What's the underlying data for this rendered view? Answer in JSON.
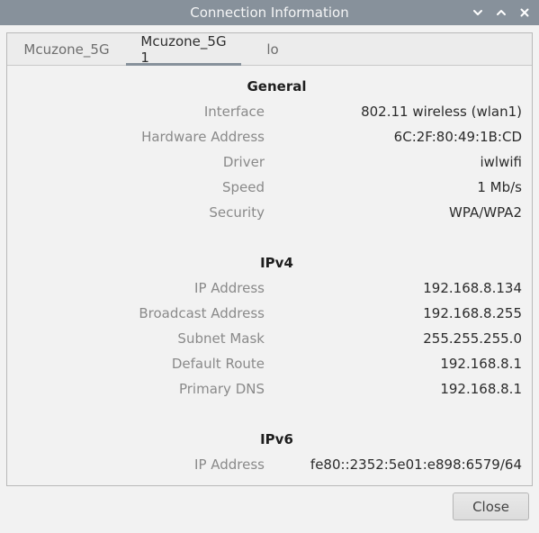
{
  "window": {
    "title": "Connection Information",
    "controls": [
      "chevron-down-icon",
      "chevron-up-icon",
      "close-icon"
    ]
  },
  "tabs": [
    {
      "label": "Mcuzone_5G",
      "active": false
    },
    {
      "label": "Mcuzone_5G 1",
      "active": true
    },
    {
      "label": "lo",
      "active": false
    }
  ],
  "general": {
    "title": "General",
    "rows": [
      {
        "label": "Interface",
        "value": "802.11 wireless (wlan1)"
      },
      {
        "label": "Hardware Address",
        "value": "6C:2F:80:49:1B:CD"
      },
      {
        "label": "Driver",
        "value": "iwlwifi"
      },
      {
        "label": "Speed",
        "value": "1 Mb/s"
      },
      {
        "label": "Security",
        "value": "WPA/WPA2"
      }
    ]
  },
  "ipv4": {
    "title": "IPv4",
    "rows": [
      {
        "label": "IP Address",
        "value": "192.168.8.134"
      },
      {
        "label": "Broadcast Address",
        "value": "192.168.8.255"
      },
      {
        "label": "Subnet Mask",
        "value": "255.255.255.0"
      },
      {
        "label": "Default Route",
        "value": "192.168.8.1"
      },
      {
        "label": "Primary DNS",
        "value": "192.168.8.1"
      }
    ]
  },
  "ipv6": {
    "title": "IPv6",
    "rows": [
      {
        "label": "IP Address",
        "value": "fe80::2352:5e01:e898:6579/64"
      }
    ]
  },
  "buttons": {
    "close_label": "Close"
  },
  "colors": {
    "titlebar": "#87919b",
    "tab_indicator": "#87919b",
    "label_text": "#8a8a8a",
    "value_text": "#2b2b2b"
  }
}
